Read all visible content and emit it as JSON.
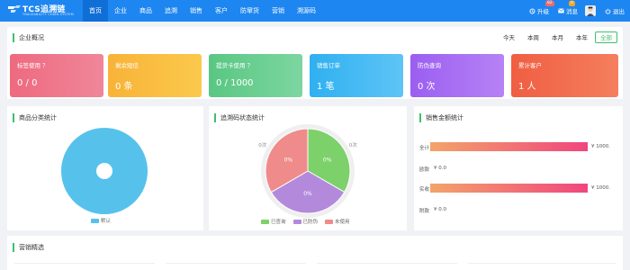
{
  "brand": {
    "title": "TCS追溯链",
    "subtitle": "TRACEABILITY CHAIN SYSTEM"
  },
  "nav": [
    "首页",
    "企业",
    "商品",
    "追溯",
    "销售",
    "客户",
    "防窜货",
    "营销",
    "溯源码"
  ],
  "nav_active_index": 0,
  "header_right": {
    "upgrade_label": "升级",
    "upgrade_badge": "82",
    "message_label": "消息",
    "message_badge": "0",
    "logout_label": "退出"
  },
  "overview": {
    "title": "企业概况",
    "time_tabs": [
      "今天",
      "本周",
      "本月",
      "本年",
      "全部"
    ],
    "active_tab_index": 4,
    "cards": [
      {
        "label": "标签使用 ？",
        "value": "0 / 0",
        "color_from": "#ee6a7f",
        "color_to": "#f0869a"
      },
      {
        "label": "剩余短信",
        "value": "0 条",
        "color_from": "#f8b338",
        "color_to": "#fbc94c"
      },
      {
        "label": "提货卡使用 ？",
        "value": "0 / 1000",
        "color_from": "#59c783",
        "color_to": "#7dd6a0"
      },
      {
        "label": "销售订单",
        "value": "1 笔",
        "color_from": "#2fb0f1",
        "color_to": "#5ec4f5"
      },
      {
        "label": "防伪查询",
        "value": "0 次",
        "color_from": "#9b5ef1",
        "color_to": "#b682f5"
      },
      {
        "label": "累计客户",
        "value": "1 人",
        "color_from": "#f05e42",
        "color_to": "#f47f5e"
      }
    ]
  },
  "category_panel": {
    "title": "商品分类统计",
    "legend": "默认",
    "color": "#56c2ec"
  },
  "code_panel": {
    "title": "追溯码状态统计",
    "slices": [
      {
        "label": "已查询",
        "percent": "0%",
        "count": "0次",
        "color": "#7dd16a",
        "share": 0.3333
      },
      {
        "label": "已防伪",
        "percent": "0%",
        "count": "0次",
        "color": "#b38adb",
        "share": 0.3333
      },
      {
        "label": "未使用",
        "percent": "0%",
        "count": "0次",
        "color": "#f08b8b",
        "share": 0.3334
      }
    ]
  },
  "sales_panel": {
    "title": "销售金额统计",
    "rows": [
      {
        "label": "全计",
        "value": "¥ 1000.",
        "fill": 1.0
      },
      {
        "label": "欧款",
        "value": "¥ 0.0",
        "fill": 0.0
      },
      {
        "label": "实收",
        "value": "¥ 1000.",
        "fill": 1.0
      },
      {
        "label": "附款",
        "value": "¥ 0.0",
        "fill": 0.0
      }
    ]
  },
  "marketing": {
    "title": "营销精选"
  }
}
